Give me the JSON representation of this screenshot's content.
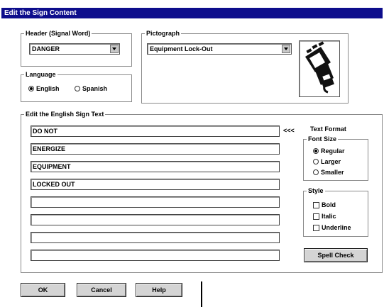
{
  "window": {
    "title": "Edit the Sign Content"
  },
  "header_group": {
    "legend": "Header (Signal Word)",
    "selected": "DANGER"
  },
  "pictograph_group": {
    "legend": "Pictograph",
    "selected": "Equipment Lock-Out",
    "icon": "lockout-hand-icon"
  },
  "language_group": {
    "legend": "Language",
    "options": [
      {
        "label": "English",
        "selected": true
      },
      {
        "label": "Spanish",
        "selected": false
      }
    ]
  },
  "sign_text_group": {
    "legend": "Edit the English Sign Text",
    "lines": [
      "DO NOT",
      "ENERGIZE",
      "EQUIPMENT",
      "LOCKED OUT",
      "",
      "",
      "",
      ""
    ],
    "marker": "<<<"
  },
  "text_format": {
    "title": "Text Format",
    "font_size_legend": "Font Size",
    "font_sizes": [
      {
        "label": "Regular",
        "selected": true
      },
      {
        "label": "Larger",
        "selected": false
      },
      {
        "label": "Smaller",
        "selected": false
      }
    ],
    "style_legend": "Style",
    "styles": [
      {
        "label": "Bold",
        "checked": false
      },
      {
        "label": "Italic",
        "checked": false
      },
      {
        "label": "Underline",
        "checked": false
      }
    ]
  },
  "buttons": {
    "spell_check": "Spell Check",
    "ok": "OK",
    "cancel": "Cancel",
    "help": "Help"
  },
  "colors": {
    "titlebar": "#0d0d8c",
    "button_face": "#d4d4d4",
    "group_border": "#8a8a8a"
  }
}
